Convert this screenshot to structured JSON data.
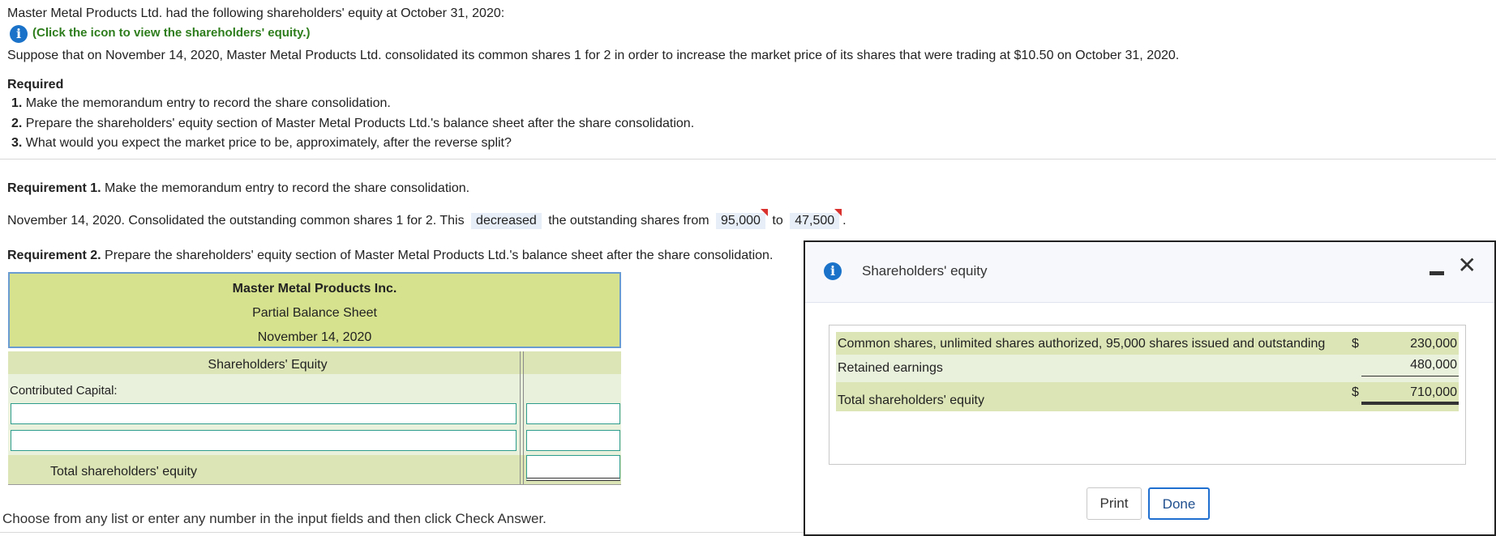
{
  "intro": {
    "line1": "Master Metal Products Ltd. had the following shareholders' equity at October 31, 2020:",
    "icon_link": "(Click the icon to view the shareholders' equity.)",
    "line2": "Suppose that on November 14, 2020, Master Metal Products Ltd. consolidated its common shares 1 for 2 in order to increase the market price of its shares that were trading at $10.50 on October 31, 2020."
  },
  "required": {
    "heading": "Required",
    "items": [
      {
        "num": "1.",
        "text": "Make the memorandum entry to record the share consolidation."
      },
      {
        "num": "2.",
        "text": "Prepare the shareholders' equity section of Master Metal Products Ltd.'s balance sheet after the share consolidation."
      },
      {
        "num": "3.",
        "text": "What would you expect the market price to be, approximately, after the reverse split?"
      }
    ]
  },
  "req1": {
    "label": "Requirement 1.",
    "text": "Make the memorandum entry to record the share consolidation.",
    "sentence_a": "November 14, 2020. Consolidated the outstanding common shares 1 for 2. This",
    "answer1": "decreased",
    "sentence_b": "the outstanding shares from",
    "answer2": "95,000",
    "sentence_c": "to",
    "answer3": "47,500",
    "sentence_d": "."
  },
  "req2": {
    "label": "Requirement 2.",
    "text": "Prepare the shareholders' equity section of Master Metal Products Ltd.'s balance sheet after the share consolidation."
  },
  "balance_sheet": {
    "company": "Master Metal Products Inc.",
    "title": "Partial Balance Sheet",
    "date": "November 14, 2020",
    "section": "Shareholders' Equity",
    "contributed": "Contributed Capital:",
    "total": "Total shareholders' equity"
  },
  "footer": "Choose from any list or enter any number in the input fields and then click Check Answer.",
  "dialog": {
    "title": "Shareholders' equity",
    "rows": [
      {
        "label": "Common shares, unlimited shares authorized, 95,000 shares issued and outstanding",
        "sign": "$",
        "value": "230,000"
      },
      {
        "label": "Retained earnings",
        "sign": "",
        "value": "480,000"
      },
      {
        "label": "Total shareholders' equity",
        "sign": "$",
        "value": "710,000"
      }
    ],
    "print_label": "Print",
    "done_label": "Done",
    "minimize_glyph": "–",
    "close_glyph": "✕"
  },
  "colors": {
    "header_green": "#d6e28e",
    "row_green": "#dbe5b6",
    "row_light": "#e9f1dd",
    "link_green": "#2e7d1d",
    "info_blue": "#1a73c8",
    "focus_blue": "#1f6fd0"
  },
  "icons": [
    "info-icon",
    "minimize-icon",
    "close-icon"
  ]
}
